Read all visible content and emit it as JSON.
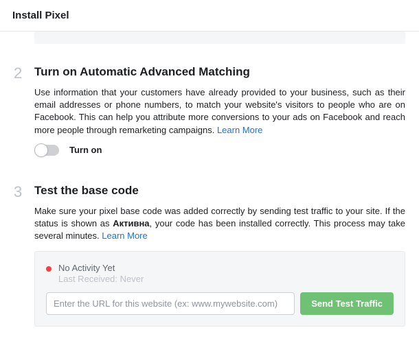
{
  "header": {
    "title": "Install Pixel"
  },
  "step2": {
    "number": "2",
    "title": "Turn on Automatic Advanced Matching",
    "desc_part1": "Use information that your customers have already provided to your business, such as their email addresses or phone numbers, to match your website's visitors to people who are on Facebook. This can help you attribute more conversions to your ads on Facebook and reach more people through remarketing campaigns. ",
    "learn_more": "Learn More",
    "toggle_label": "Turn on"
  },
  "step3": {
    "number": "3",
    "title": "Test the base code",
    "desc_part1": "Make sure your pixel base code was added correctly by sending test traffic to your site. If the status is shown as ",
    "desc_bold": "Активна",
    "desc_part2": ", your code has been installed correctly. This process may take several minutes. ",
    "learn_more": "Learn More"
  },
  "test_panel": {
    "status_main": "No Activity Yet",
    "status_sub": "Last Received: Never",
    "input_placeholder": "Enter the URL for this website (ex: www.mywebsite.com)",
    "button_label": "Send Test Traffic"
  }
}
